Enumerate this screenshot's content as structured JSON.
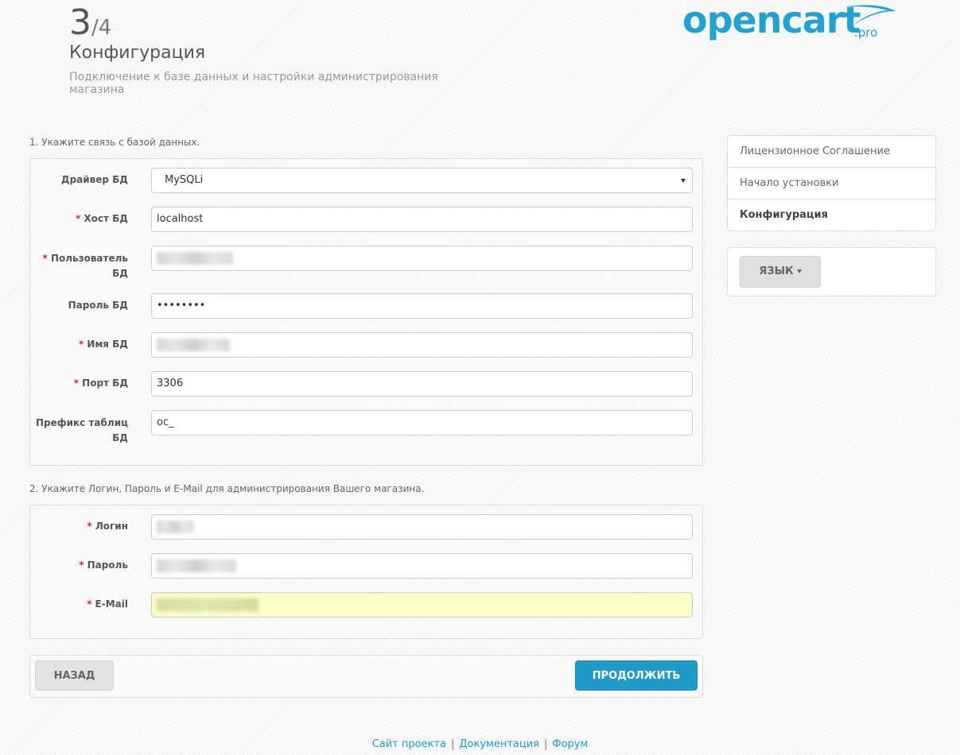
{
  "header": {
    "step_current": "3",
    "step_total": "4",
    "title": "Конфигурация",
    "subtitle": "Подключение к базе данных и настройки администрирования магазина",
    "logo_word": "opencart",
    "logo_suffix": ".pro"
  },
  "db_section": {
    "legend": "1. Укажите связь с базой данных.",
    "fields": [
      {
        "label": "Драйвер БД",
        "required": false,
        "value": "MySQLi"
      },
      {
        "label": "Хост БД",
        "required": true,
        "value": "localhost"
      },
      {
        "label": "Пользователь БД",
        "required": true,
        "value": ""
      },
      {
        "label": "Пароль БД",
        "required": false,
        "value": "••••••••"
      },
      {
        "label": "Имя БД",
        "required": true,
        "value": ""
      },
      {
        "label": "Порт БД",
        "required": true,
        "value": "3306"
      },
      {
        "label": "Префикс таблиц БД",
        "required": false,
        "value": "oc_"
      }
    ]
  },
  "admin_section": {
    "legend": "2. Укажите Логин, Пароль и E-Mail для администрирования Вашего магазина.",
    "fields": [
      {
        "label": "Логин",
        "required": true,
        "value": ""
      },
      {
        "label": "Пароль",
        "required": true,
        "value": ""
      },
      {
        "label": "E-Mail",
        "required": true,
        "value": ""
      }
    ]
  },
  "actions": {
    "back_label": "НАЗАД",
    "continue_label": "ПРОДОЛЖИТЬ"
  },
  "sidebar": {
    "steps": [
      {
        "label": "Лицензионное Соглашение",
        "active": false
      },
      {
        "label": "Начало установки",
        "active": false
      },
      {
        "label": "Конфигурация",
        "active": true
      }
    ],
    "language_button": "ЯЗЫК"
  },
  "footer": {
    "links": [
      "Сайт проекта",
      "Документация",
      "Форум"
    ]
  },
  "colors": {
    "accent": "#229ac8",
    "logo": "#23a1d1",
    "required": "#c9302c",
    "autofill": "#fafdc6"
  }
}
